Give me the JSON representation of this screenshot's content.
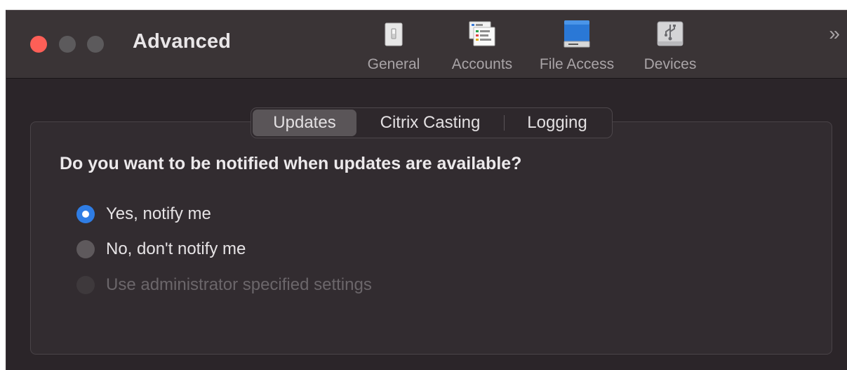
{
  "window": {
    "title": "Advanced"
  },
  "toolbar": {
    "items": [
      {
        "label": "General",
        "icon": "switch-icon"
      },
      {
        "label": "Accounts",
        "icon": "accounts-icon"
      },
      {
        "label": "File Access",
        "icon": "drive-icon"
      },
      {
        "label": "Devices",
        "icon": "usb-icon"
      }
    ],
    "overflow": "»"
  },
  "tabs": {
    "items": [
      "Updates",
      "Citrix Casting",
      "Logging"
    ],
    "selected": "Updates"
  },
  "content": {
    "question": "Do you want to be notified when updates are available?",
    "options": [
      {
        "label": "Yes, notify me",
        "checked": true,
        "enabled": true
      },
      {
        "label": "No, don't notify me",
        "checked": false,
        "enabled": true
      },
      {
        "label": "Use administrator specified settings",
        "checked": false,
        "enabled": false
      }
    ]
  },
  "colors": {
    "accent": "#2f7de4",
    "close": "#fe5f57",
    "background": "#2b2529"
  }
}
